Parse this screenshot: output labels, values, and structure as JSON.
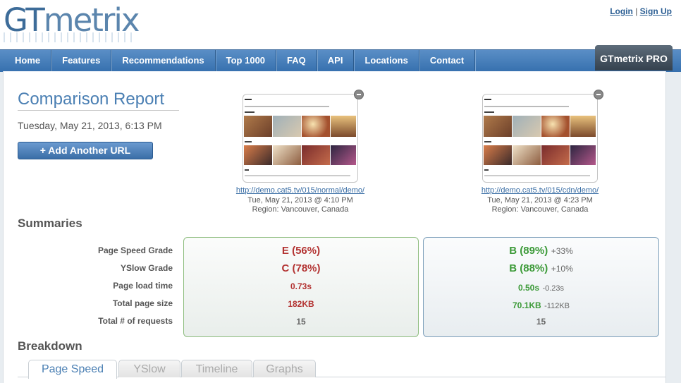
{
  "header": {
    "logo_gt": "GT",
    "logo_rest": "metrix",
    "login": "Login",
    "separator": "|",
    "signup": "Sign Up"
  },
  "nav": {
    "items": [
      "Home",
      "Features",
      "Recommendations",
      "Top 1000",
      "FAQ",
      "API",
      "Locations",
      "Contact"
    ],
    "pro_label": "GTmetrix PRO"
  },
  "report": {
    "title": "Comparison Report",
    "date": "Tuesday, May 21, 2013, 6:13 PM",
    "add_button": "+ Add Another URL"
  },
  "pages": [
    {
      "url": "http://demo.cat5.tv/015/normal/demo/",
      "tested": "Tue, May 21, 2013 @ 4:10 PM",
      "region": "Region: Vancouver, Canada"
    },
    {
      "url": "http://demo.cat5.tv/015/cdn/demo/",
      "tested": "Tue, May 21, 2013 @ 4:23 PM",
      "region": "Region: Vancouver, Canada"
    }
  ],
  "summaries": {
    "heading": "Summaries",
    "labels": [
      "Page Speed Grade",
      "YSlow Grade",
      "Page load time",
      "Total page size",
      "Total # of requests"
    ],
    "a": {
      "pagespeed": "E (56%)",
      "yslow": "C (78%)",
      "load": "0.73s",
      "size": "182KB",
      "requests": "15"
    },
    "b": {
      "pagespeed": "B (89%)",
      "pagespeed_delta": "+33%",
      "yslow": "B (88%)",
      "yslow_delta": "+10%",
      "load": "0.50s",
      "load_delta": "-0.23s",
      "size": "70.1KB",
      "size_delta": "-112KB",
      "requests": "15"
    }
  },
  "breakdown": {
    "heading": "Breakdown",
    "tabs": [
      "Page Speed",
      "YSlow",
      "Timeline",
      "Graphs"
    ],
    "active_tab": "Page Speed"
  },
  "colors": {
    "accent": "#4a7fb3",
    "bad": "#b33332",
    "good": "#3c9a38",
    "nav": "#3670ae"
  }
}
